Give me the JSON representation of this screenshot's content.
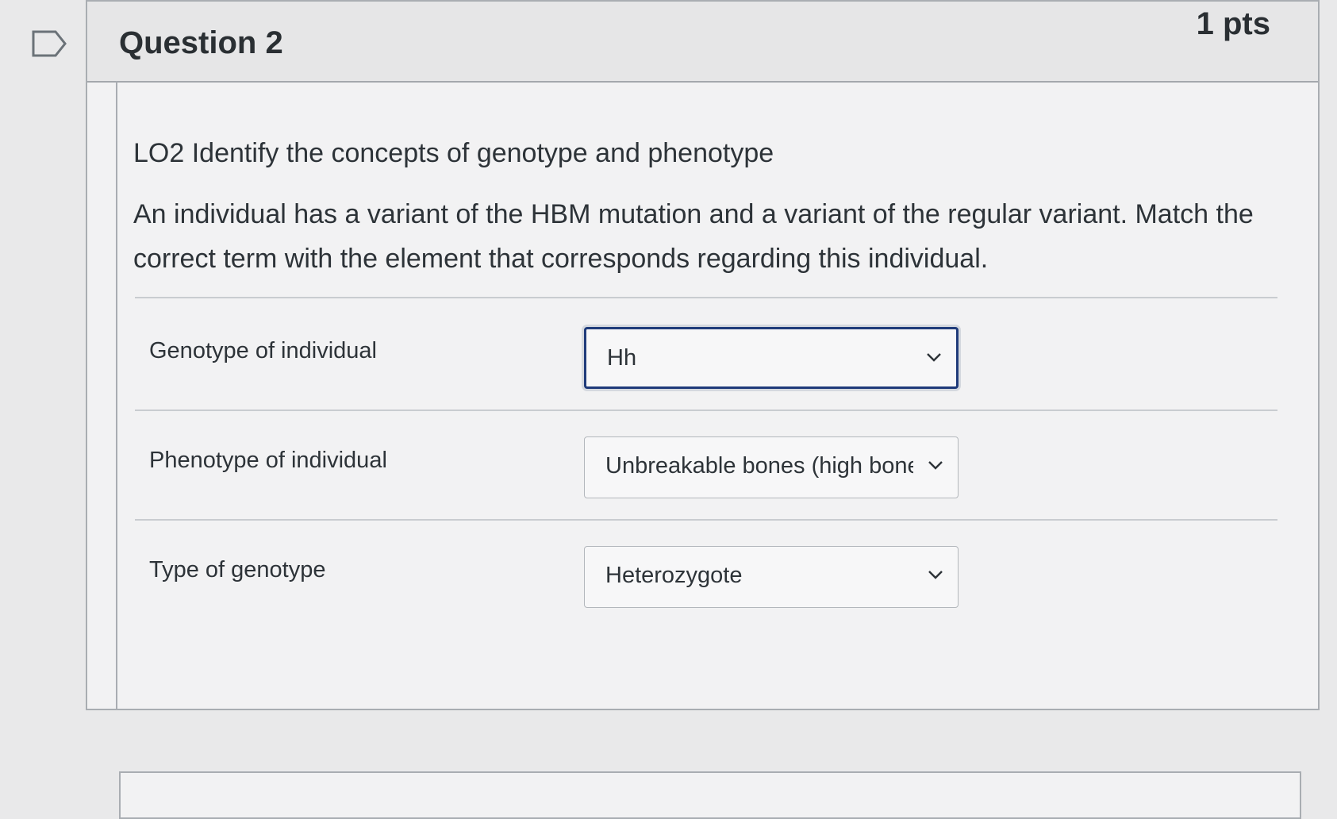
{
  "question": {
    "title": "Question 2",
    "points": "1 pts",
    "objective": "LO2 Identify the concepts of genotype and phenotype",
    "prompt": "An individual has a variant of the HBM mutation and a variant of the regular variant. Match the correct term with the element that corresponds regarding this individual.",
    "flag_icon": "bookmark-flag-icon"
  },
  "matches": [
    {
      "label": "Genotype of individual",
      "selected": "Hh"
    },
    {
      "label": "Phenotype of individual",
      "selected": "Unbreakable bones (high bone"
    },
    {
      "label": "Type of genotype",
      "selected": "Heterozygote"
    }
  ],
  "colors": {
    "focus_border": "#1f3b7a",
    "text": "#2d3338",
    "header_bg": "#e6e6e7"
  }
}
